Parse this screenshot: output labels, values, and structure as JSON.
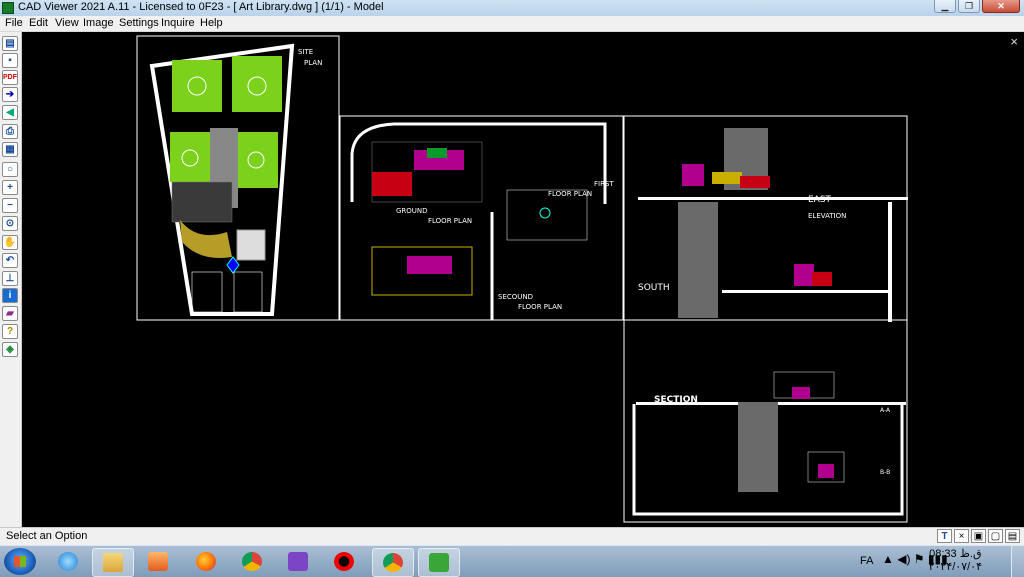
{
  "window": {
    "title": "CAD Viewer 2021 A.11 - Licensed to 0F23  -  [ Art Library.dwg ] (1/1)  -  Model",
    "minimize": "▁",
    "maximize": "❐",
    "close": "✕"
  },
  "menu": [
    "File",
    "Edit",
    "View",
    "Image",
    "Settings",
    "Inquire",
    "Help"
  ],
  "toolbar_icons": [
    "open-icon",
    "save-icon",
    "pdf-icon",
    "forward-arrow-icon",
    "back-arrow-icon",
    "print-icon",
    "layers-icon",
    "zoom-icon",
    "zoom-in-icon",
    "zoom-out-icon",
    "zoom-window-icon",
    "pan-hand-icon",
    "undo-icon",
    "measure-icon",
    "info-icon",
    "book-icon",
    "help-icon",
    "layout-icon"
  ],
  "toolbar_pdf_label": "PDF",
  "drawing_labels": {
    "site": "SITE",
    "site_plan": "PLAN",
    "ground": "GROUND",
    "ground_plan": "FLOOR PLAN",
    "first": "FIRST",
    "first_plan": "FLOOR PLAN",
    "second": "SECOUND",
    "second_plan": "FLOOR PLAN",
    "east": "EAST",
    "elevation": "ELEVATION",
    "south": "SOUTH",
    "section": "SECTION",
    "sec_aa": "A-A",
    "sec_bb": "B-B"
  },
  "canvas_close": "×",
  "status": {
    "text": "Select an Option",
    "tools": [
      "T",
      "×",
      "▣",
      "▢",
      "▤"
    ]
  },
  "taskbar": {
    "apps": [
      "start-button",
      "ie-icon",
      "explorer-icon",
      "media-icon",
      "firefox-icon",
      "chrome-icon",
      "vs-icon",
      "opera-icon",
      "chrome-profile-icon",
      "cad-viewer-icon"
    ],
    "language": "FA",
    "time": "08:33 ق.ظ",
    "date": "۲۰۲۴/۰۷/۰۴"
  }
}
